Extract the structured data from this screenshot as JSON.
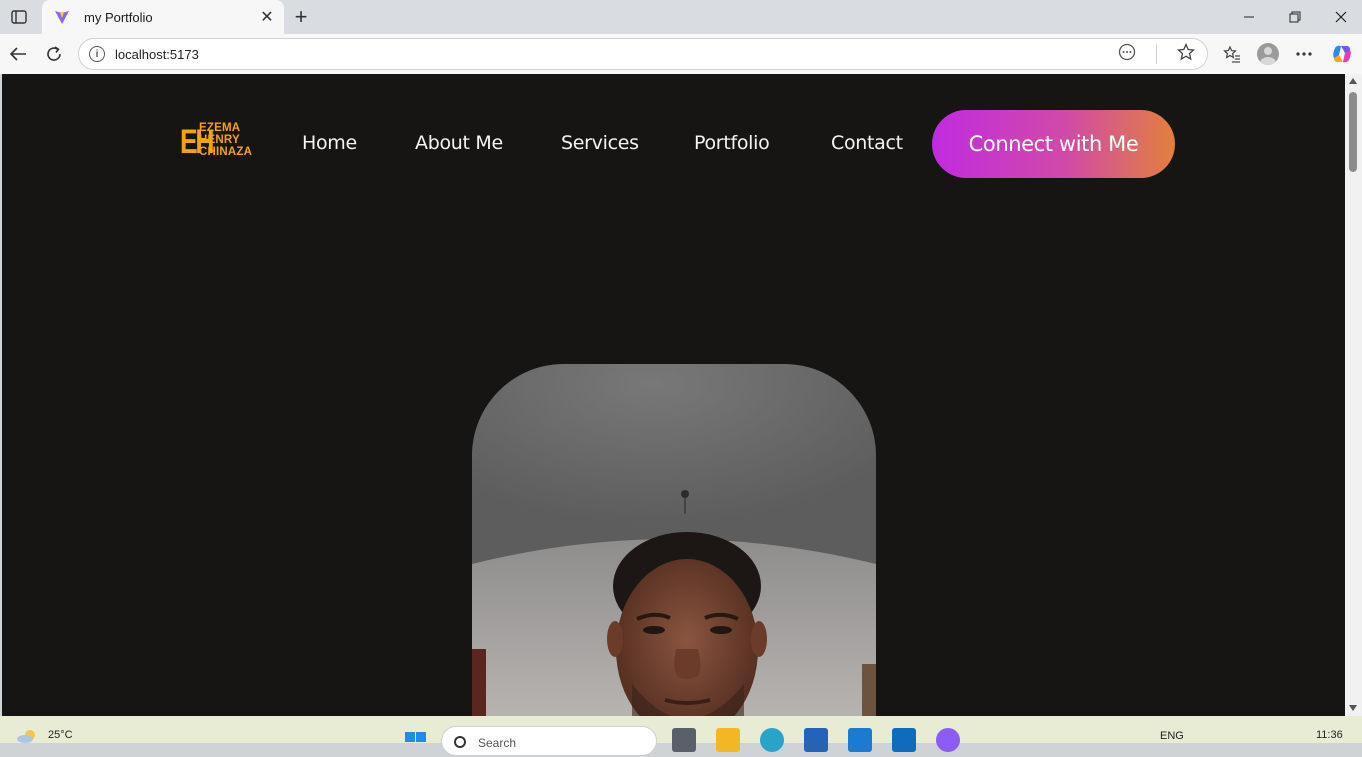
{
  "browser": {
    "tab_title": "my Portfolio",
    "url": "localhost:5173",
    "window_controls": [
      "minimize-icon",
      "restore-icon",
      "close-icon"
    ]
  },
  "site": {
    "logo": {
      "mark": "EH",
      "lines": [
        "EZEMA",
        "HENRY",
        "CHINAZA"
      ]
    },
    "nav": {
      "links": [
        "Home",
        "About Me",
        "Services",
        "Portfolio",
        "Contact"
      ],
      "cta": "Connect with Me"
    },
    "colors": {
      "background": "#161513",
      "logo": "#f2a30f",
      "cta_gradient_start": "#c12be0",
      "cta_gradient_end": "#e2803c"
    }
  },
  "taskbar": {
    "temperature": "25°C",
    "search_placeholder": "Search",
    "language": "ENG",
    "time": "11:36"
  }
}
